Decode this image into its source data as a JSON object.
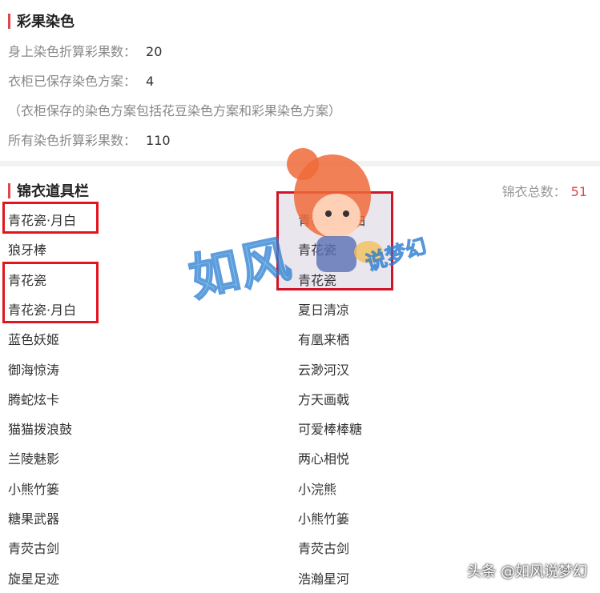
{
  "dye_section": {
    "title": "彩果染色",
    "rows": [
      {
        "label": "身上染色折算彩果数：",
        "value": "20"
      },
      {
        "label": "衣柜已保存染色方案：",
        "value": "4"
      }
    ],
    "note": "（衣柜保存的染色方案包括花豆染色方案和彩果染色方案）",
    "total_row": {
      "label": "所有染色折算彩果数：",
      "value": "110"
    }
  },
  "brocade_section": {
    "title": "锦衣道具栏",
    "total_label": "锦衣总数：",
    "total_value": "51",
    "left_items": [
      "青花瓷·月白",
      "狼牙棒",
      "青花瓷",
      "青花瓷·月白",
      "蓝色妖姬",
      "御海惊涛",
      "腾蛇炫卡",
      "猫猫拨浪鼓",
      "兰陵魅影",
      "小熊竹篓",
      "糖果武器",
      "青荧古剑",
      "旋星足迹"
    ],
    "right_items": [
      "青花瓷·月白",
      "青花瓷",
      "青花瓷",
      "夏日清凉",
      "有凰来栖",
      "云渺河汉",
      "方天画戟",
      "可爱棒棒糖",
      "两心相悦",
      "小浣熊",
      "小熊竹篓",
      "青荧古剑",
      "浩瀚星河"
    ]
  },
  "watermark": {
    "main": "如风",
    "sub": "说梦幻"
  },
  "credit": "头条 @如风说梦幻",
  "colors": {
    "accent": "#e0464b",
    "highlight": "#e3141e"
  }
}
